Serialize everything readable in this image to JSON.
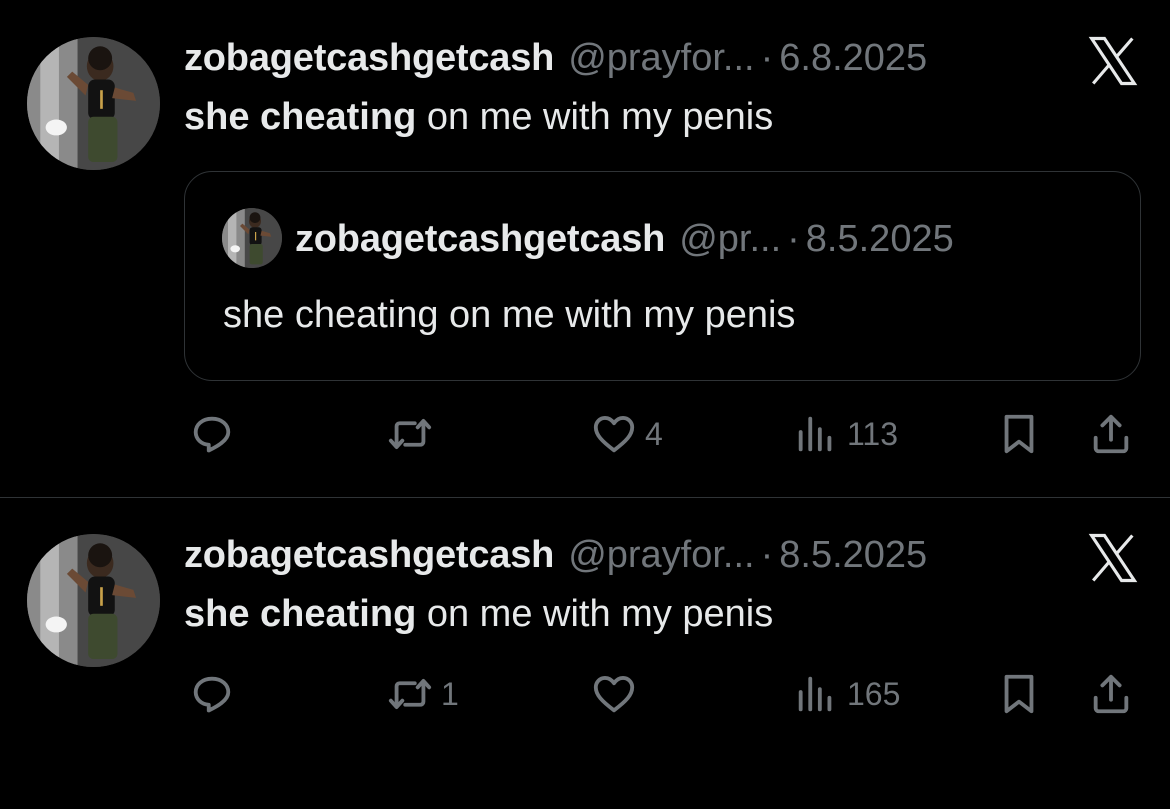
{
  "colors": {
    "background": "#000000",
    "primary_text": "#e7e9ea",
    "secondary_text": "#71767b",
    "border": "#2f3336"
  },
  "tweets": [
    {
      "display_name": "zobagetcashgetcash",
      "handle": "@prayfor...",
      "separator": "·",
      "date": "6.8.2025",
      "text_bold": "she cheating",
      "text_rest": " on me with my penis",
      "platform_icon": "x-logo-icon",
      "quote": {
        "display_name": "zobagetcashgetcash",
        "handle": "@pr...",
        "separator": "·",
        "date": "8.5.2025",
        "text": "she cheating on me with my penis"
      },
      "actions": {
        "reply_icon": "reply-icon",
        "reply_count": "",
        "retweet_icon": "retweet-icon",
        "retweet_count": "",
        "like_icon": "heart-icon",
        "like_count": "4",
        "views_icon": "views-icon",
        "views_count": "113",
        "bookmark_icon": "bookmark-icon",
        "share_icon": "share-icon"
      }
    },
    {
      "display_name": "zobagetcashgetcash",
      "handle": "@prayfor...",
      "separator": "·",
      "date": "8.5.2025",
      "text_bold": "she cheating",
      "text_rest": " on me with my penis",
      "platform_icon": "x-logo-icon",
      "actions": {
        "reply_icon": "reply-icon",
        "reply_count": "",
        "retweet_icon": "retweet-icon",
        "retweet_count": "1",
        "like_icon": "heart-icon",
        "like_count": "",
        "views_icon": "views-icon",
        "views_count": "165",
        "bookmark_icon": "bookmark-icon",
        "share_icon": "share-icon"
      }
    }
  ]
}
